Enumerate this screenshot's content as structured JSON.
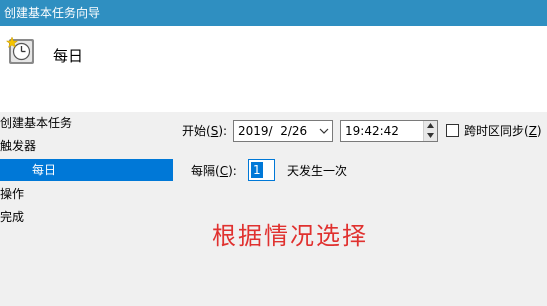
{
  "window": {
    "title": "创建基本任务向导"
  },
  "header": {
    "title": "每日",
    "icon": "clock-icon"
  },
  "sidebar": {
    "items": [
      {
        "label": "创建基本任务",
        "selected": false
      },
      {
        "label": "触发器",
        "selected": false
      },
      {
        "label": "每日",
        "selected": true
      },
      {
        "label": "操作",
        "selected": false
      },
      {
        "label": "完成",
        "selected": false
      }
    ]
  },
  "start": {
    "label_prefix": "开始(",
    "label_key": "S",
    "label_suffix": "):",
    "date_value": "2019/  2/26",
    "time_value": "19:42:42"
  },
  "timezone": {
    "label_prefix": "跨时区同步(",
    "label_key": "Z",
    "label_suffix": ")",
    "checked": false
  },
  "recur": {
    "label_prefix": "每隔(",
    "label_key": "C",
    "label_suffix": "):",
    "value": "1",
    "suffix": "天发生一次"
  },
  "annotation": {
    "text": "根据情况选择",
    "color": "#e0312f"
  },
  "colors": {
    "titlebar": "#2f8fc1",
    "selection": "#0078d7"
  }
}
